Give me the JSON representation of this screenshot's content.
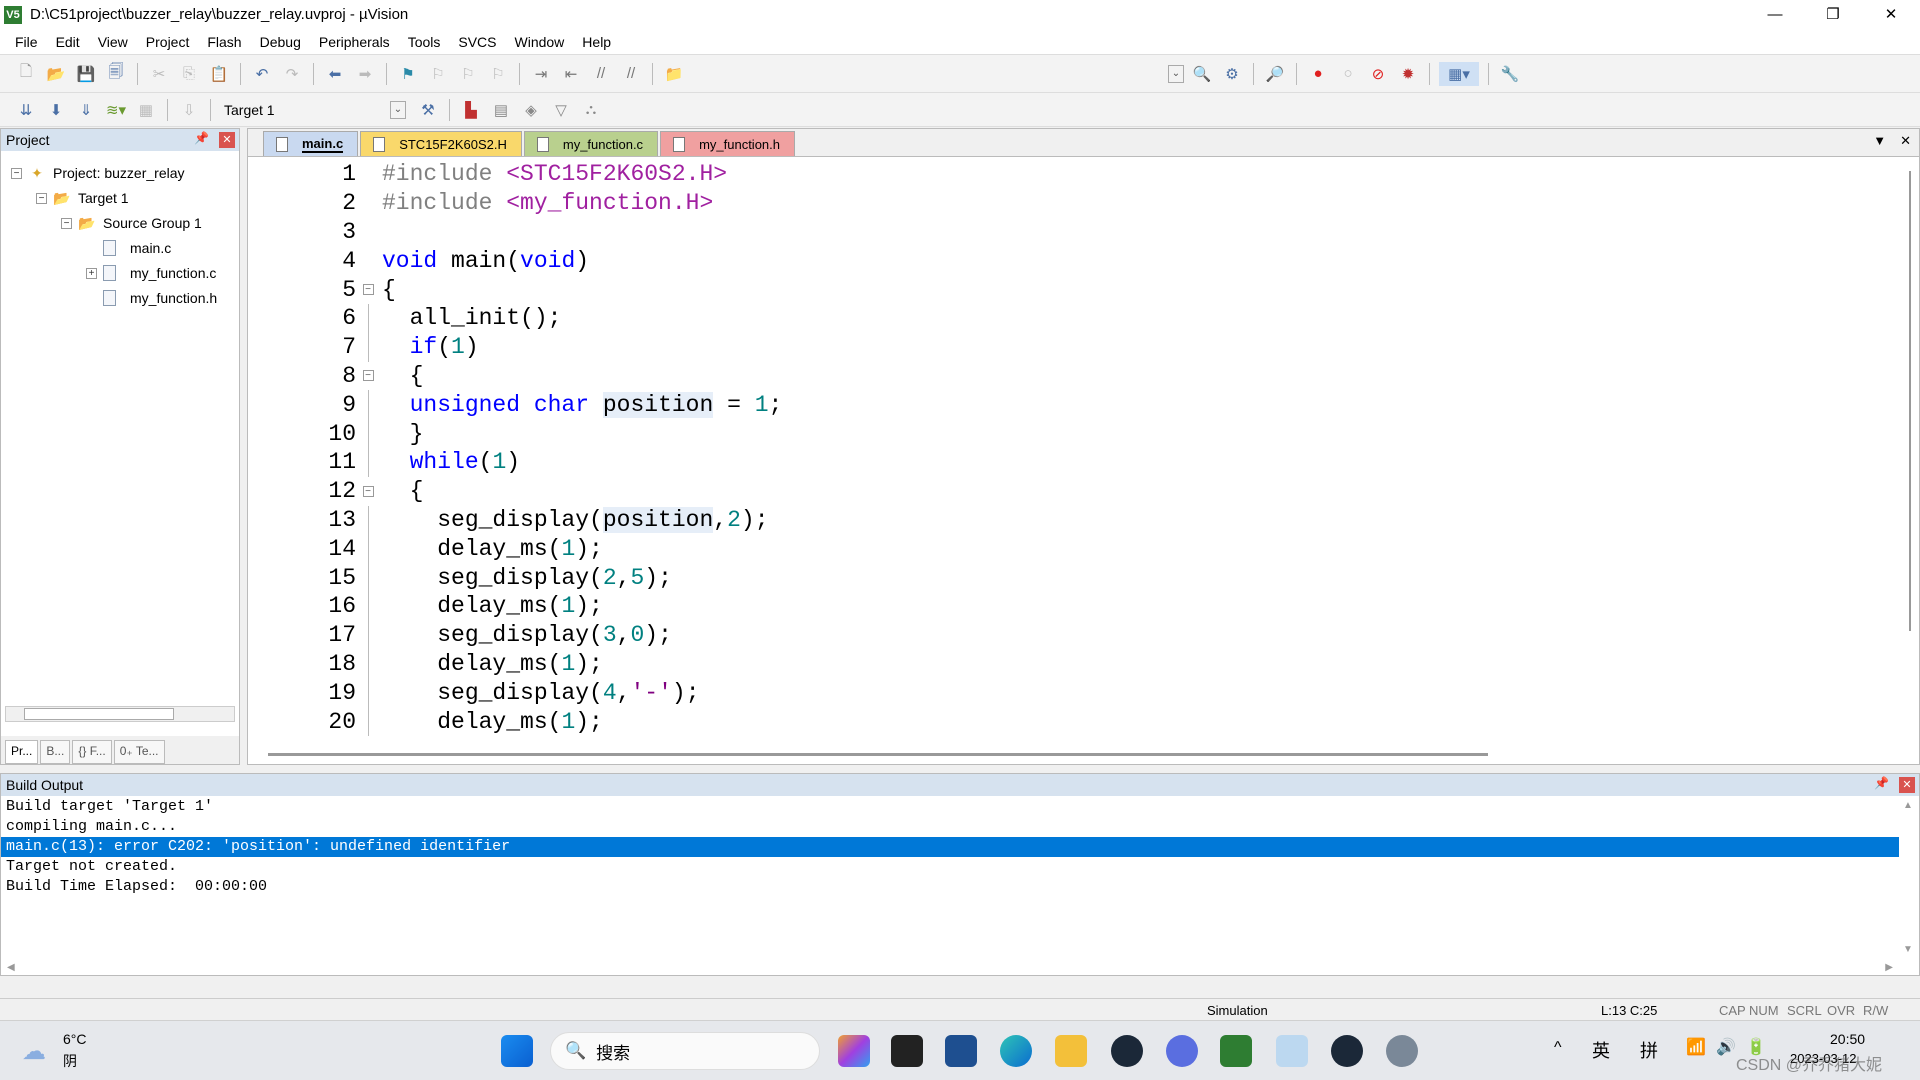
{
  "window": {
    "title": "D:\\C51project\\buzzer_relay\\buzzer_relay.uvproj - µVision",
    "logo": "V5",
    "minimize": "—",
    "restore": "❐",
    "close": "✕"
  },
  "menu": [
    "File",
    "Edit",
    "View",
    "Project",
    "Flash",
    "Debug",
    "Peripherals",
    "Tools",
    "SVCS",
    "Window",
    "Help"
  ],
  "toolbar2": {
    "target": "Target 1"
  },
  "project": {
    "header": "Project",
    "tree": [
      {
        "label": "Project: buzzer_relay",
        "level": 0,
        "expander": "−",
        "icon": "project"
      },
      {
        "label": "Target 1",
        "level": 1,
        "expander": "−",
        "icon": "folder"
      },
      {
        "label": "Source Group 1",
        "level": 2,
        "expander": "−",
        "icon": "folder"
      },
      {
        "label": "main.c",
        "level": 3,
        "expander": "",
        "icon": "file"
      },
      {
        "label": "my_function.c",
        "level": 3,
        "expander": "+",
        "icon": "file"
      },
      {
        "label": "my_function.h",
        "level": 3,
        "expander": "",
        "icon": "file"
      }
    ],
    "bottom_tabs": [
      "Pr...",
      "B...",
      "{} F...",
      "0₊ Te..."
    ]
  },
  "editor": {
    "tabs": [
      {
        "label": "main.c",
        "color": "#c9d9f0",
        "active": true
      },
      {
        "label": "STC15F2K60S2.H",
        "color": "#f9d86b",
        "active": false
      },
      {
        "label": "my_function.c",
        "color": "#b9d08e",
        "active": false
      },
      {
        "label": "my_function.h",
        "color": "#f0a0a0",
        "active": false
      }
    ],
    "lines": [
      {
        "n": "1",
        "fold": "",
        "tokens": [
          [
            "pp",
            "#include "
          ],
          [
            "inc",
            "<STC15F2K60S2.H>"
          ]
        ]
      },
      {
        "n": "2",
        "fold": "",
        "tokens": [
          [
            "pp",
            "#include "
          ],
          [
            "inc",
            "<my_function.H>"
          ]
        ]
      },
      {
        "n": "3",
        "fold": "",
        "tokens": []
      },
      {
        "n": "4",
        "fold": "",
        "tokens": [
          [
            "kw",
            "void"
          ],
          [
            "id",
            " main("
          ],
          [
            "kw",
            "void"
          ],
          [
            "id",
            ")"
          ]
        ]
      },
      {
        "n": "5",
        "fold": "box",
        "tokens": [
          [
            "id",
            "{"
          ]
        ]
      },
      {
        "n": "6",
        "fold": "line",
        "tokens": [
          [
            "id",
            "  all_init();"
          ]
        ]
      },
      {
        "n": "7",
        "fold": "line",
        "tokens": [
          [
            "id",
            "  "
          ],
          [
            "kw",
            "if"
          ],
          [
            "id",
            "("
          ],
          [
            "num",
            "1"
          ],
          [
            "id",
            ")"
          ]
        ]
      },
      {
        "n": "8",
        "fold": "box",
        "tokens": [
          [
            "id",
            "  {"
          ]
        ]
      },
      {
        "n": "9",
        "fold": "line",
        "tokens": [
          [
            "id",
            "  "
          ],
          [
            "kw",
            "unsigned char"
          ],
          [
            "id",
            " "
          ],
          [
            "hl",
            "position"
          ],
          [
            "id",
            " = "
          ],
          [
            "num",
            "1"
          ],
          [
            "id",
            ";"
          ]
        ]
      },
      {
        "n": "10",
        "fold": "line",
        "tokens": [
          [
            "id",
            "  }"
          ]
        ]
      },
      {
        "n": "11",
        "fold": "line",
        "tokens": [
          [
            "id",
            "  "
          ],
          [
            "kw",
            "while"
          ],
          [
            "id",
            "("
          ],
          [
            "num",
            "1"
          ],
          [
            "id",
            ")"
          ]
        ]
      },
      {
        "n": "12",
        "fold": "box",
        "tokens": [
          [
            "id",
            "  {"
          ]
        ]
      },
      {
        "n": "13",
        "fold": "line",
        "tokens": [
          [
            "id",
            "    seg_display("
          ],
          [
            "hl",
            "position"
          ],
          [
            "id",
            ","
          ],
          [
            "num",
            "2"
          ],
          [
            "id",
            ");"
          ]
        ]
      },
      {
        "n": "14",
        "fold": "line",
        "tokens": [
          [
            "id",
            "    delay_ms("
          ],
          [
            "num",
            "1"
          ],
          [
            "id",
            ");"
          ]
        ]
      },
      {
        "n": "15",
        "fold": "line",
        "tokens": [
          [
            "id",
            "    seg_display("
          ],
          [
            "num",
            "2"
          ],
          [
            "id",
            ","
          ],
          [
            "num",
            "5"
          ],
          [
            "id",
            ");"
          ]
        ]
      },
      {
        "n": "16",
        "fold": "line",
        "tokens": [
          [
            "id",
            "    delay_ms("
          ],
          [
            "num",
            "1"
          ],
          [
            "id",
            ");"
          ]
        ]
      },
      {
        "n": "17",
        "fold": "line",
        "tokens": [
          [
            "id",
            "    seg_display("
          ],
          [
            "num",
            "3"
          ],
          [
            "id",
            ","
          ],
          [
            "num",
            "0"
          ],
          [
            "id",
            ");"
          ]
        ]
      },
      {
        "n": "18",
        "fold": "line",
        "tokens": [
          [
            "id",
            "    delay_ms("
          ],
          [
            "num",
            "1"
          ],
          [
            "id",
            ");"
          ]
        ]
      },
      {
        "n": "19",
        "fold": "line",
        "tokens": [
          [
            "id",
            "    seg_display("
          ],
          [
            "num",
            "4"
          ],
          [
            "id",
            ","
          ],
          [
            "str",
            "'-'"
          ],
          [
            "id",
            ");"
          ]
        ]
      },
      {
        "n": "20",
        "fold": "line",
        "tokens": [
          [
            "id",
            "    delay_ms("
          ],
          [
            "num",
            "1"
          ],
          [
            "id",
            ");"
          ]
        ]
      }
    ]
  },
  "build": {
    "header": "Build Output",
    "lines": [
      {
        "text": "Build target 'Target 1'",
        "selected": false
      },
      {
        "text": "compiling main.c...",
        "selected": false
      },
      {
        "text": "main.c(13): error C202: 'position': undefined identifier",
        "selected": true
      },
      {
        "text": "Target not created.",
        "selected": false
      },
      {
        "text": "Build Time Elapsed:  00:00:00",
        "selected": false
      }
    ]
  },
  "status": {
    "mode": "Simulation",
    "cursor": "L:13 C:25",
    "cap": "CAP",
    "num": "NUM",
    "scrl": "SCRL",
    "ovr": "OVR",
    "rw": "R/W"
  },
  "taskbar": {
    "weather_temp": "6°C",
    "weather_desc": "阴",
    "search_placeholder": "搜索",
    "ime1": "英",
    "ime2": "拼",
    "time": "20:50",
    "date": "2023-03-12",
    "watermark": "CSDN @乔乔猪大妮"
  }
}
